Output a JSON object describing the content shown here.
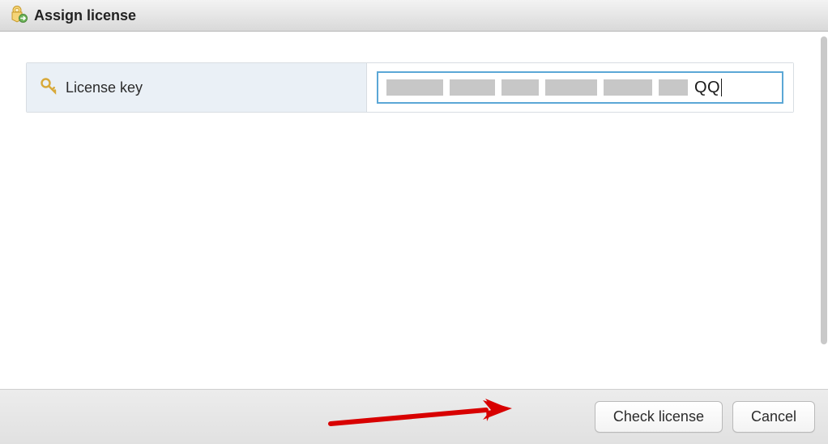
{
  "dialog": {
    "title": "Assign license"
  },
  "form": {
    "license_label": "License key",
    "license_value_tail": "QQ"
  },
  "footer": {
    "check_label": "Check license",
    "cancel_label": "Cancel"
  }
}
